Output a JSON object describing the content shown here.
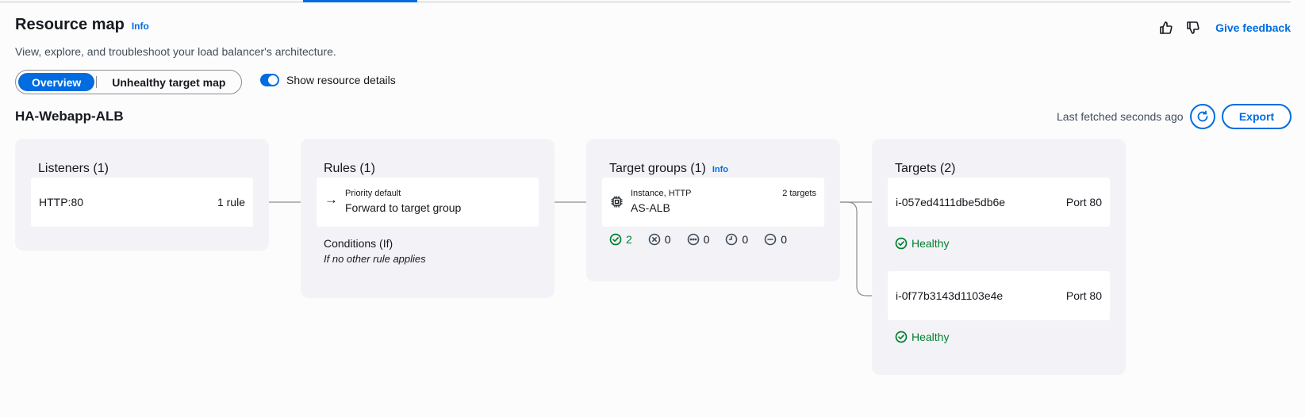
{
  "header": {
    "title": "Resource map",
    "info": "Info",
    "description": "View, explore, and troubleshoot your load balancer's architecture.",
    "give_feedback": "Give feedback"
  },
  "view_toggle": {
    "options": [
      "Overview",
      "Unhealthy target map"
    ],
    "selected": "Overview"
  },
  "show_details": {
    "label": "Show resource details",
    "enabled": true
  },
  "load_balancer": {
    "name": "HA-Webapp-ALB",
    "last_fetched": "Last fetched seconds ago",
    "export_label": "Export"
  },
  "listeners": {
    "title": "Listeners (1)",
    "items": [
      {
        "name": "HTTP:80",
        "rules": "1 rule"
      }
    ]
  },
  "rules": {
    "title": "Rules (1)",
    "items": [
      {
        "priority": "Priority default",
        "action": "Forward to target group"
      }
    ],
    "conditions_title": "Conditions (If)",
    "conditions_value": "If no other rule applies"
  },
  "target_groups": {
    "title": "Target groups (1)",
    "info": "Info",
    "items": [
      {
        "type": "Instance, HTTP",
        "name": "AS-ALB",
        "targets": "2 targets"
      }
    ],
    "stats": {
      "healthy": "2",
      "unhealthy": "0",
      "unused": "0",
      "draining": "0",
      "unavailable": "0"
    }
  },
  "targets": {
    "title": "Targets (2)",
    "items": [
      {
        "id": "i-057ed4111dbe5db6e",
        "port": "Port 80",
        "status": "Healthy"
      },
      {
        "id": "i-0f77b3143d1103e4e",
        "port": "Port 80",
        "status": "Healthy"
      }
    ]
  },
  "colors": {
    "accent": "#006ce0",
    "healthy": "#00802f",
    "panel": "#f3f3f7",
    "connector": "#8c8c94"
  }
}
